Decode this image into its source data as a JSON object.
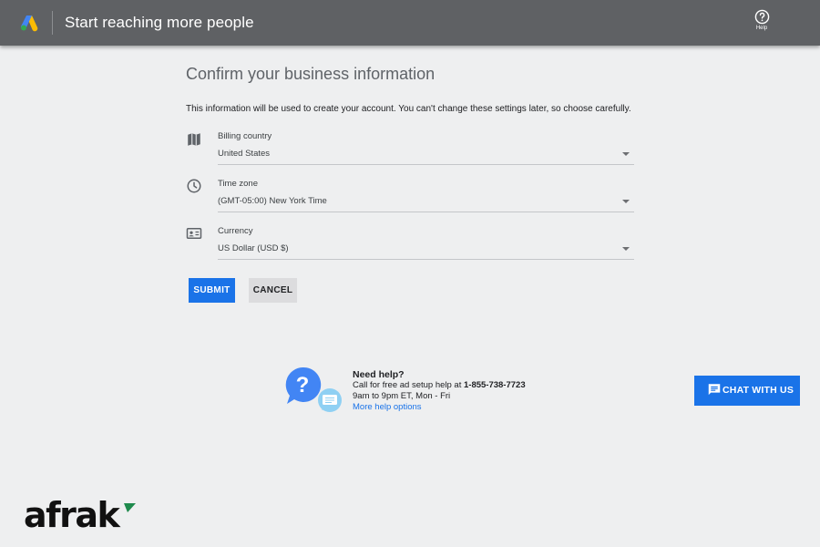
{
  "header": {
    "title": "Start reaching more people",
    "help_label": "Help",
    "logo_name": "google-ads-logo"
  },
  "main": {
    "heading": "Confirm your business information",
    "intro": "This information will be used to create your account. You can't change these settings later, so choose carefully.",
    "fields": [
      {
        "icon": "map-icon",
        "label": "Billing country",
        "value": "United States"
      },
      {
        "icon": "clock-icon",
        "label": "Time zone",
        "value": "(GMT-05:00) New York Time"
      },
      {
        "icon": "currency-icon",
        "label": "Currency",
        "value": "US Dollar (USD $)"
      }
    ],
    "submit_label": "SUBMIT",
    "cancel_label": "CANCEL"
  },
  "help_section": {
    "title": "Need help?",
    "call_text": "Call for free ad setup help at ",
    "phone": "1-855-738-7723",
    "hours": "9am to 9pm ET, Mon - Fri",
    "more_link": "More help options"
  },
  "chat": {
    "label": "CHAT WITH US"
  },
  "watermark": {
    "text": "afrak"
  },
  "colors": {
    "header_bg": "#5f6164",
    "page_bg": "#eeeff0",
    "primary_blue": "#1a73e8",
    "cancel_bg": "#dcdcde",
    "watermark_green": "#1e8a4c"
  }
}
